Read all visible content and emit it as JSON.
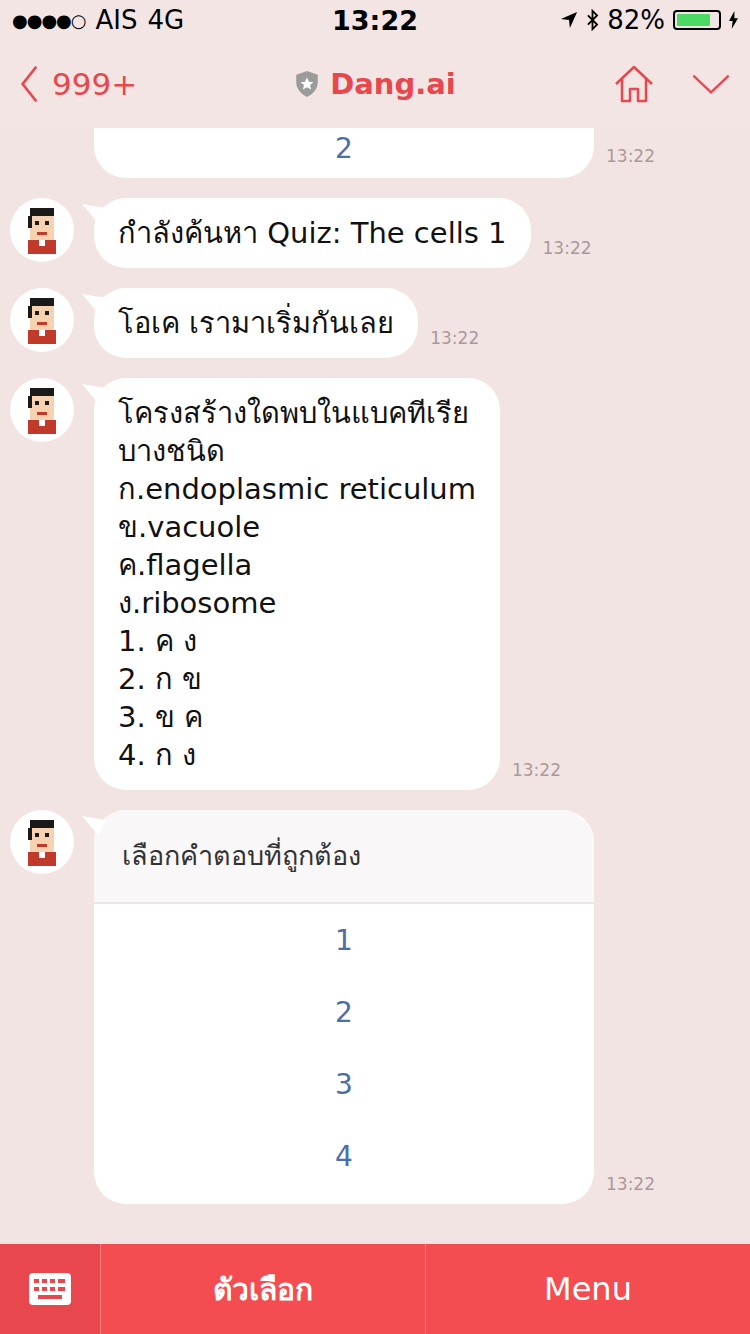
{
  "status_bar": {
    "signal": "●●●●○",
    "carrier": "AIS",
    "network": "4G",
    "time": "13:22",
    "battery": "82%",
    "battery_level": 0.82
  },
  "header": {
    "back_count": "999+",
    "title": "Dang.ai"
  },
  "messages": [
    {
      "kind": "partial_card",
      "options": [
        "2"
      ],
      "time": "13:22"
    },
    {
      "kind": "text",
      "lines": [
        "กำลังค้นหา Quiz: The cells 1"
      ],
      "time": "13:22"
    },
    {
      "kind": "text",
      "lines": [
        "โอเค เรามาเริ่มกันเลย"
      ],
      "time": "13:22"
    },
    {
      "kind": "text",
      "lines": [
        "โครงสร้างใดพบในแบคทีเรีย",
        "บางชนิด",
        "ก.endoplasmic reticulum",
        "ข.vacuole",
        "ค.flagella",
        "ง.ribosome",
        "1. ค ง",
        "2. ก ข",
        "3. ข ค",
        "4. ก ง"
      ],
      "time": "13:22"
    },
    {
      "kind": "card",
      "title": "เลือกคำตอบที่ถูกต้อง",
      "options": [
        "1",
        "2",
        "3",
        "4"
      ],
      "time": "13:22"
    }
  ],
  "bottom_bar": {
    "options_label": "ตัวเลือก",
    "menu_label": "Menu"
  }
}
